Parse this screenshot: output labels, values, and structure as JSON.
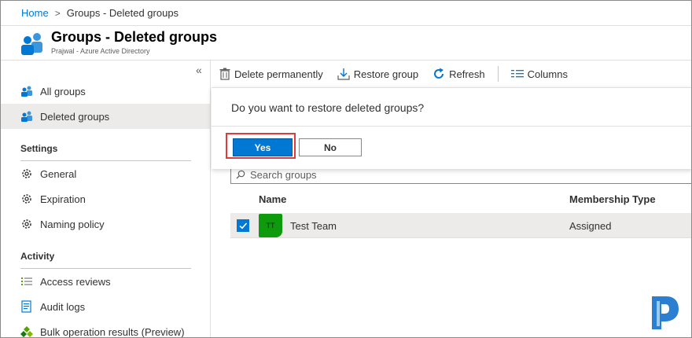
{
  "breadcrumb": {
    "home": "Home",
    "separator": ">",
    "current": "Groups - Deleted groups"
  },
  "header": {
    "title": "Groups - Deleted groups",
    "subtitle": "Prajwal - Azure Active Directory"
  },
  "sidebar": {
    "collapse": "«",
    "items": [
      {
        "label": "All groups",
        "icon": "groups-icon"
      },
      {
        "label": "Deleted groups",
        "icon": "groups-icon",
        "selected": true
      }
    ],
    "settings": {
      "title": "Settings",
      "items": [
        {
          "label": "General",
          "icon": "gear-icon"
        },
        {
          "label": "Expiration",
          "icon": "gear-icon"
        },
        {
          "label": "Naming policy",
          "icon": "gear-icon"
        }
      ]
    },
    "activity": {
      "title": "Activity",
      "items": [
        {
          "label": "Access reviews",
          "icon": "list-icon"
        },
        {
          "label": "Audit logs",
          "icon": "log-icon"
        },
        {
          "label": "Bulk operation results (Preview)",
          "icon": "bulk-icon"
        }
      ]
    }
  },
  "toolbar": {
    "delete_label": "Delete permanently",
    "restore_label": "Restore group",
    "refresh_label": "Refresh",
    "columns_label": "Columns"
  },
  "dialog": {
    "question": "Do you want to restore deleted groups?",
    "yes_label": "Yes",
    "no_label": "No"
  },
  "search": {
    "placeholder": "Search groups"
  },
  "table": {
    "columns": [
      "Name",
      "Membership Type"
    ],
    "rows": [
      {
        "initials": "TT",
        "name": "Test Team",
        "membership": "Assigned",
        "selected": true
      }
    ]
  },
  "colors": {
    "accent": "#0078d4",
    "avatar": "#0d9b0d",
    "highlight": "#e03a3a"
  }
}
